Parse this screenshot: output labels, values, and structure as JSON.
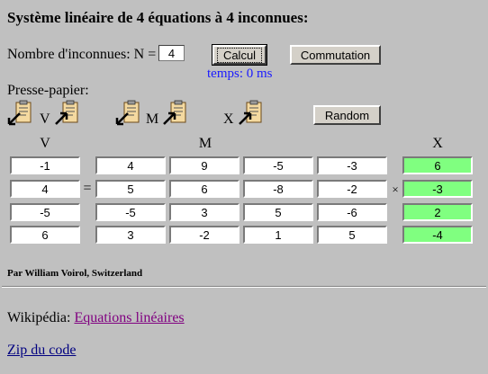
{
  "title": "Système linéaire de 4 équations à 4 inconnues:",
  "controls": {
    "n_label": "Nombre d'inconnues: N =",
    "n_value": "4",
    "calcul_label": "Calcul",
    "commutation_label": "Commutation",
    "random_label": "Random",
    "timing": "temps: 0 ms"
  },
  "clipboard": {
    "label": "Presse-papier:",
    "v_letter": "V",
    "m_letter": "M",
    "x_letter": "X"
  },
  "headers": {
    "v": "V",
    "m": "M",
    "x": "X"
  },
  "operators": {
    "equals": "=",
    "times": "×"
  },
  "system": {
    "v": [
      "-1",
      "4",
      "-5",
      "6"
    ],
    "m": [
      [
        "4",
        "9",
        "-5",
        "-3"
      ],
      [
        "5",
        "6",
        "-8",
        "-2"
      ],
      [
        "-5",
        "3",
        "5",
        "-6"
      ],
      [
        "3",
        "-2",
        "1",
        "5"
      ]
    ],
    "x": [
      "6",
      "-3",
      "2",
      "-4"
    ]
  },
  "colors": {
    "solution_cell": "#80ff80",
    "timing_text": "#1a1aff",
    "background": "#c0c0c0"
  },
  "footer": {
    "author": "Par William Voirol, Switzerland",
    "wiki_prefix": "Wikipédia:",
    "wiki_link": "Equations linéaires",
    "zip_link": "Zip du code"
  },
  "icons": {
    "paste": "clipboard-paste-icon",
    "copy": "clipboard-copy-icon"
  }
}
